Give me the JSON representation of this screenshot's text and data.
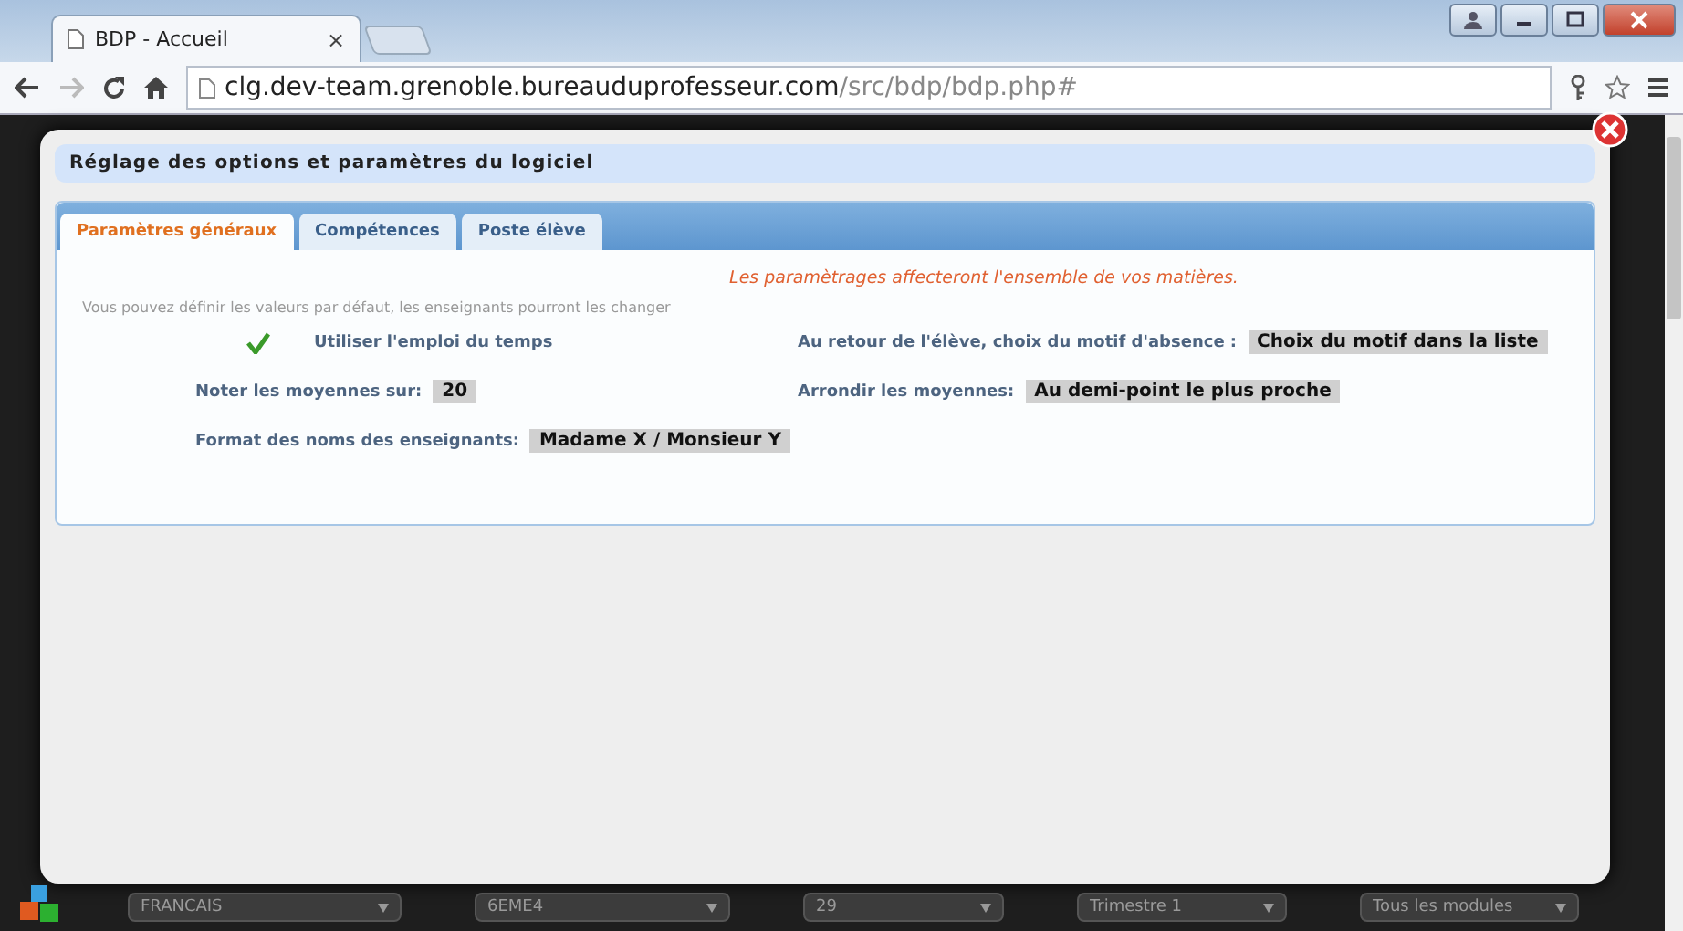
{
  "browser": {
    "tab_title": "BDP - Accueil",
    "tab_close": "×",
    "url_host": "clg.dev-team.grenoble.bureauduprofesseur.com",
    "url_path": "/src/bdp/bdp.php#"
  },
  "dialog": {
    "title": "Réglage des options et paramètres du logiciel",
    "tabs": [
      {
        "label": "Paramètres généraux",
        "selected": true
      },
      {
        "label": "Compétences",
        "selected": false
      },
      {
        "label": "Poste élève",
        "selected": false
      }
    ],
    "notice": "Les paramètrages affecteront l'ensemble de vos matières.",
    "hint": "Vous pouvez définir les valeurs par défaut, les enseignants pourront les changer",
    "use_timetable": {
      "label": "Utiliser l'emploi du temps",
      "checked": true
    },
    "absence_reason": {
      "label": "Au retour de l'élève, choix du motif d'absence :",
      "value": "Choix du motif dans la liste"
    },
    "grade_scale": {
      "label": "Noter les moyennes sur:",
      "value": "20"
    },
    "rounding": {
      "label": "Arrondir les moyennes:",
      "value": "Au demi-point le plus proche"
    },
    "teacher_name_format": {
      "label": "Format des noms des enseignants:",
      "value": "Madame X / Monsieur Y"
    }
  },
  "bottom_bar": {
    "selects": [
      "FRANCAIS",
      "6EME4",
      "29",
      "Trimestre 1",
      "Tous les modules"
    ]
  }
}
